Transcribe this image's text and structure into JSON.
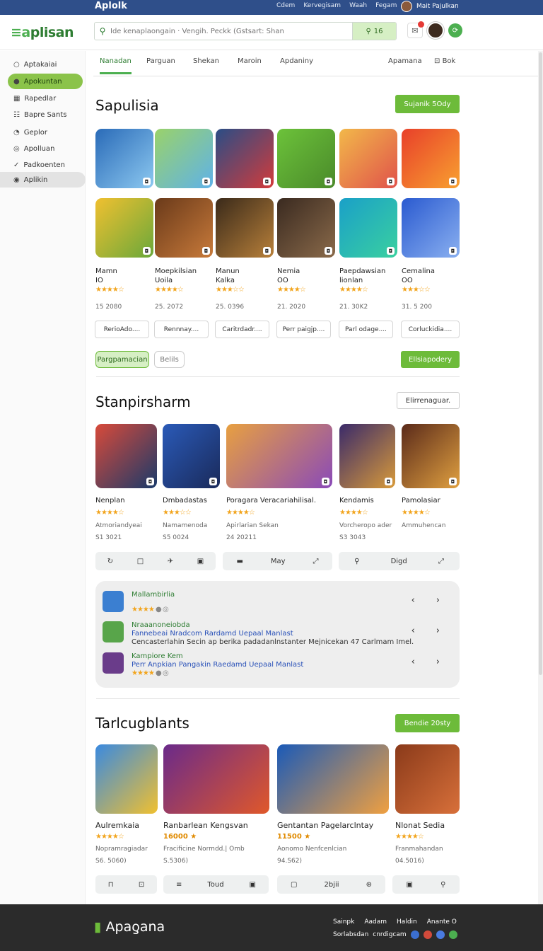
{
  "topbar": {
    "brand": "Aplolk",
    "links": [
      "Cdem",
      "Kervegisam",
      "Waah",
      "Fegam"
    ],
    "user": "Mait Pajulkan"
  },
  "header": {
    "logo": "plisan",
    "search_placeholder": "Ide kenaplaongain · Vengih. Peckk (Gstsart: Shan",
    "search_button": "16"
  },
  "sidebar": {
    "items": [
      {
        "label": "Aptakaiai",
        "icon": "circle-icon"
      },
      {
        "label": "Apokuntan",
        "icon": "leaf-icon"
      },
      {
        "label": "Rapedlar",
        "icon": "grid-icon"
      },
      {
        "label": "Bapre Sants",
        "icon": "list-icon"
      },
      {
        "label": "Geplor",
        "icon": "gauge-icon"
      },
      {
        "label": "Apolluan",
        "icon": "target-icon"
      },
      {
        "label": "Padkoenten",
        "icon": "check-icon"
      },
      {
        "label": "Aplikin",
        "icon": "circle-fill-icon"
      }
    ]
  },
  "tabs": [
    "Nanadan",
    "Parguan",
    "Shekan",
    "Maroin",
    "Apdaniny",
    "Apamana",
    "Bok"
  ],
  "section1": {
    "title": "Sapulisia",
    "action": "Sujanik 5Ody",
    "apps": [
      {
        "name": "Mamn",
        "sub": "IO",
        "rating": 4,
        "count": "15 2080",
        "btn": "RerioAdo...."
      },
      {
        "name": "Moepkilsian",
        "sub": "Uoila",
        "rating": 4,
        "count": "25. 2072",
        "btn": "Rennnay...."
      },
      {
        "name": "Manun",
        "sub": "Kalka",
        "rating": 3,
        "count": "25. 0396",
        "btn": "Caritrdadr...."
      },
      {
        "name": "Nemia",
        "sub": "OO",
        "rating": 4,
        "count": "21. 2020",
        "btn": "Perr paigjp...."
      },
      {
        "name": "Paepdawsian",
        "sub": "lionlan",
        "rating": 4,
        "count": "21. 30K2",
        "btn": "Parl odage...."
      },
      {
        "name": "Cemalina",
        "sub": "OO",
        "rating": 3,
        "count": "31. 5 200",
        "btn": "Corluckidia...."
      }
    ],
    "pill_active": "Pargpamacian",
    "pill_other": "Belils",
    "more": "Ellsiapodery"
  },
  "section2": {
    "title": "Stanpirsharm",
    "action": "Elirrenaguar.",
    "apps": [
      {
        "name": "Nenplan",
        "desc": "Atmoriandyeai",
        "num": "S1 3021",
        "rating": 4
      },
      {
        "name": "Dmbadastas",
        "desc": "Namamenoda",
        "num": "S5 0024",
        "rating": 3
      },
      {
        "name": "Poragara Veracariahilisal.",
        "desc": "Apirlarian Sekan",
        "num": "24 20211",
        "rating": 4
      },
      {
        "name": "Kendamis",
        "desc": "Vorcheropo ader",
        "num": "S3 3043",
        "rating": 4
      },
      {
        "name": "Pamolasiar",
        "desc": "Ammuhencan",
        "num": "",
        "rating": 4
      }
    ],
    "tools": [
      "May",
      "Digd"
    ]
  },
  "reviews": [
    {
      "title": "Mallambirlia",
      "sub": "",
      "quote": "",
      "rating": 4
    },
    {
      "title": "Nraaanoneiobda",
      "sub": "Fannebeai  Nradcom Rardamd Uepaal Manlast",
      "quote": "Cencasterlahin Secin ap berika padadanlnstanter Mejnicekan 47 Carlmam Imel.",
      "rating": 0
    },
    {
      "title": "Kampiore Kem",
      "sub": "Perr Anpkian Pangakin Raedamd Uepaal Manlast",
      "quote": "",
      "rating": 4
    }
  ],
  "section3": {
    "title": "Tarlcugblants",
    "action": "Bendie 20sty",
    "apps": [
      {
        "name": "Aulremkaia",
        "price": "",
        "desc": "Nopramragiadar",
        "num": "S6. 5060)",
        "rating": 4
      },
      {
        "name": "Ranbarlean Kengsvan",
        "price": "16000",
        "desc": "Fracificine Normdd.| Omb",
        "num": "S.5306)",
        "rating": 1
      },
      {
        "name": "Gentantan Pagelarclntay",
        "price": "11500",
        "desc": "Aonomo Nenfcenlcian",
        "num": "94.S62)",
        "rating": 1
      },
      {
        "name": "Nlonat Sedia",
        "price": "",
        "desc": "Franmahandan",
        "num": "04.5016)",
        "rating": 4
      }
    ],
    "tools": [
      "Toud",
      "2bjii"
    ]
  },
  "footer": {
    "logo": "Apaƍana",
    "links": [
      "Sainpk",
      "Aadam",
      "Haldin",
      "Anante O"
    ],
    "links2": [
      "Sorlabsdan",
      "cnrdigcam"
    ]
  },
  "colors": {
    "accent": "#6dbb3a",
    "topbar": "#2f4f8a",
    "star": "#f2a41c"
  }
}
